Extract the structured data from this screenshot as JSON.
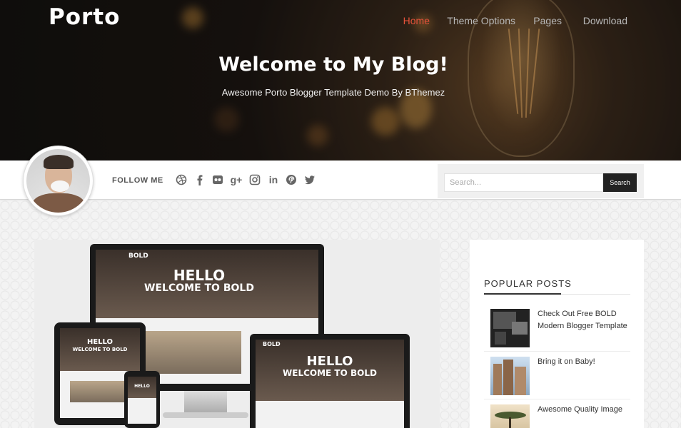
{
  "brand": {
    "logo": "Porto"
  },
  "nav": {
    "items": [
      {
        "label": "Home",
        "active": true
      },
      {
        "label": "Theme Options",
        "active": false
      },
      {
        "label": "Pages",
        "active": false
      },
      {
        "label": "Download",
        "active": false
      }
    ]
  },
  "hero": {
    "title": "Welcome to My Blog!",
    "subtitle": "Awesome Porto Blogger Template Demo By BThemez"
  },
  "profile": {
    "follow_label": "FOLLOW ME",
    "social_icons": [
      "dribbble-icon",
      "facebook-icon",
      "flickr-icon",
      "google-plus-icon",
      "instagram-icon",
      "linkedin-icon",
      "pinterest-icon",
      "twitter-icon"
    ]
  },
  "search": {
    "placeholder": "Search...",
    "button_label": "Search"
  },
  "featured": {
    "screen_brand": "BOLD",
    "hello": "HELLO",
    "welcome": "WELCOME TO BOLD"
  },
  "sidebar": {
    "title": "POPULAR POSTS",
    "posts": [
      {
        "title": "Check Out Free BOLD Modern Blogger Template"
      },
      {
        "title": "Bring it on Baby!"
      },
      {
        "title": "Awesome Quality Image"
      }
    ]
  },
  "colors": {
    "accent": "#e7523a",
    "dark": "#222222"
  }
}
